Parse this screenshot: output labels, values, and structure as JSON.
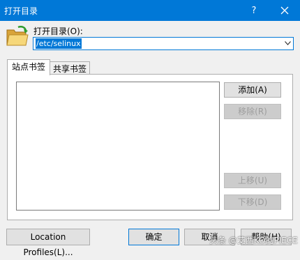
{
  "window": {
    "title": "打开目录",
    "help_glyph": "?",
    "close_glyph": "✕"
  },
  "directory": {
    "label": "打开目录(O):",
    "value": "/etc/selinux"
  },
  "tabs": [
    {
      "label": "站点书签",
      "active": true
    },
    {
      "label": "共享书签",
      "active": false
    }
  ],
  "bookmarks": [],
  "side_buttons": {
    "add": "添加(A)",
    "remove": "移除(R)",
    "move_up": "上移(U)",
    "move_down": "下移(D)"
  },
  "bottom_buttons": {
    "location_profiles": "Location Profiles(L)...",
    "ok": "确定",
    "cancel": "取消",
    "help": "帮助(H)"
  },
  "watermark": "头条 @艾西KO的PIECE",
  "colors": {
    "accent": "#0078d7",
    "disabled_text": "#9d9d9d"
  }
}
